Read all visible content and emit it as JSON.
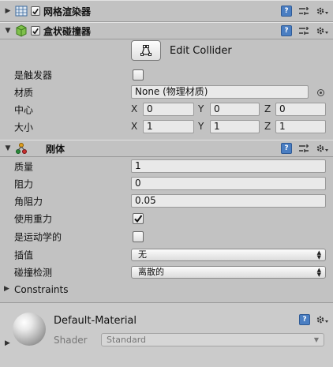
{
  "mesh_renderer": {
    "title": "网格渲染器",
    "icon": "mesh-renderer-icon",
    "enabled": true
  },
  "box_collider": {
    "title": "盒状碰撞器",
    "icon": "box-collider-icon",
    "enabled": true,
    "edit_collider_label": "Edit Collider",
    "is_trigger": {
      "label": "是触发器",
      "checked": false
    },
    "material": {
      "label": "材质",
      "value": "None (物理材质)"
    },
    "center": {
      "label": "中心",
      "x_label": "X",
      "y_label": "Y",
      "z_label": "Z",
      "x": "0",
      "y": "0",
      "z": "0"
    },
    "size": {
      "label": "大小",
      "x_label": "X",
      "y_label": "Y",
      "z_label": "Z",
      "x": "1",
      "y": "1",
      "z": "1"
    }
  },
  "rigidbody": {
    "title": "刚体",
    "icon": "rigidbody-icon",
    "mass": {
      "label": "质量",
      "value": "1"
    },
    "drag": {
      "label": "阻力",
      "value": "0"
    },
    "angular_drag": {
      "label": "角阻力",
      "value": "0.05"
    },
    "use_gravity": {
      "label": "使用重力",
      "checked": true
    },
    "is_kinematic": {
      "label": "是运动学的",
      "checked": false
    },
    "interpolate": {
      "label": "插值",
      "value": "无"
    },
    "collision_detection": {
      "label": "碰撞检测",
      "value": "离散的"
    },
    "constraints": {
      "label": "Constraints"
    }
  },
  "material": {
    "name": "Default-Material",
    "shader_label": "Shader",
    "shader_value": "Standard"
  },
  "colors": {
    "background": "#c2c2c2",
    "field": "#e9e9e9",
    "help_blue": "#4a7ec2"
  }
}
